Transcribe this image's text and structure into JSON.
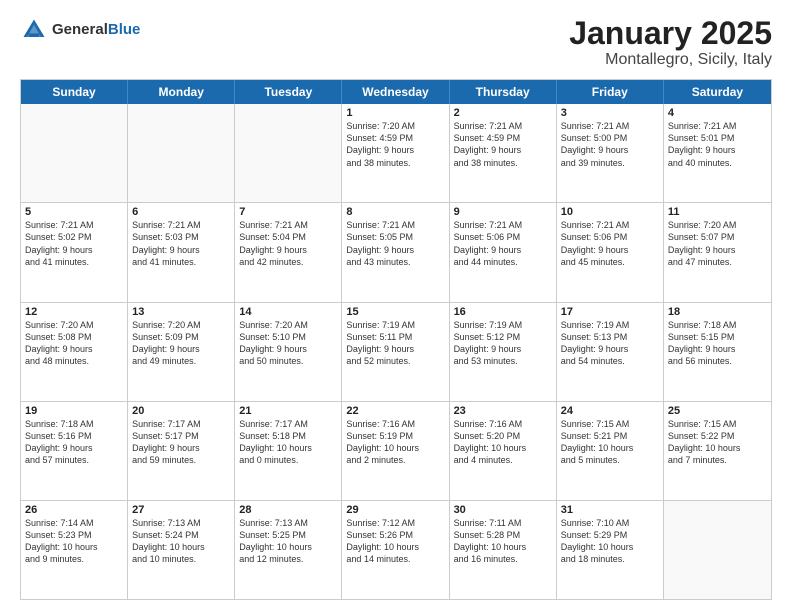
{
  "header": {
    "logo": {
      "general": "General",
      "blue": "Blue"
    },
    "title": "January 2025",
    "location": "Montallegro, Sicily, Italy"
  },
  "dayHeaders": [
    "Sunday",
    "Monday",
    "Tuesday",
    "Wednesday",
    "Thursday",
    "Friday",
    "Saturday"
  ],
  "weeks": [
    [
      {
        "day": "",
        "info": ""
      },
      {
        "day": "",
        "info": ""
      },
      {
        "day": "",
        "info": ""
      },
      {
        "day": "1",
        "info": "Sunrise: 7:20 AM\nSunset: 4:59 PM\nDaylight: 9 hours\nand 38 minutes."
      },
      {
        "day": "2",
        "info": "Sunrise: 7:21 AM\nSunset: 4:59 PM\nDaylight: 9 hours\nand 38 minutes."
      },
      {
        "day": "3",
        "info": "Sunrise: 7:21 AM\nSunset: 5:00 PM\nDaylight: 9 hours\nand 39 minutes."
      },
      {
        "day": "4",
        "info": "Sunrise: 7:21 AM\nSunset: 5:01 PM\nDaylight: 9 hours\nand 40 minutes."
      }
    ],
    [
      {
        "day": "5",
        "info": "Sunrise: 7:21 AM\nSunset: 5:02 PM\nDaylight: 9 hours\nand 41 minutes."
      },
      {
        "day": "6",
        "info": "Sunrise: 7:21 AM\nSunset: 5:03 PM\nDaylight: 9 hours\nand 41 minutes."
      },
      {
        "day": "7",
        "info": "Sunrise: 7:21 AM\nSunset: 5:04 PM\nDaylight: 9 hours\nand 42 minutes."
      },
      {
        "day": "8",
        "info": "Sunrise: 7:21 AM\nSunset: 5:05 PM\nDaylight: 9 hours\nand 43 minutes."
      },
      {
        "day": "9",
        "info": "Sunrise: 7:21 AM\nSunset: 5:06 PM\nDaylight: 9 hours\nand 44 minutes."
      },
      {
        "day": "10",
        "info": "Sunrise: 7:21 AM\nSunset: 5:06 PM\nDaylight: 9 hours\nand 45 minutes."
      },
      {
        "day": "11",
        "info": "Sunrise: 7:20 AM\nSunset: 5:07 PM\nDaylight: 9 hours\nand 47 minutes."
      }
    ],
    [
      {
        "day": "12",
        "info": "Sunrise: 7:20 AM\nSunset: 5:08 PM\nDaylight: 9 hours\nand 48 minutes."
      },
      {
        "day": "13",
        "info": "Sunrise: 7:20 AM\nSunset: 5:09 PM\nDaylight: 9 hours\nand 49 minutes."
      },
      {
        "day": "14",
        "info": "Sunrise: 7:20 AM\nSunset: 5:10 PM\nDaylight: 9 hours\nand 50 minutes."
      },
      {
        "day": "15",
        "info": "Sunrise: 7:19 AM\nSunset: 5:11 PM\nDaylight: 9 hours\nand 52 minutes."
      },
      {
        "day": "16",
        "info": "Sunrise: 7:19 AM\nSunset: 5:12 PM\nDaylight: 9 hours\nand 53 minutes."
      },
      {
        "day": "17",
        "info": "Sunrise: 7:19 AM\nSunset: 5:13 PM\nDaylight: 9 hours\nand 54 minutes."
      },
      {
        "day": "18",
        "info": "Sunrise: 7:18 AM\nSunset: 5:15 PM\nDaylight: 9 hours\nand 56 minutes."
      }
    ],
    [
      {
        "day": "19",
        "info": "Sunrise: 7:18 AM\nSunset: 5:16 PM\nDaylight: 9 hours\nand 57 minutes."
      },
      {
        "day": "20",
        "info": "Sunrise: 7:17 AM\nSunset: 5:17 PM\nDaylight: 9 hours\nand 59 minutes."
      },
      {
        "day": "21",
        "info": "Sunrise: 7:17 AM\nSunset: 5:18 PM\nDaylight: 10 hours\nand 0 minutes."
      },
      {
        "day": "22",
        "info": "Sunrise: 7:16 AM\nSunset: 5:19 PM\nDaylight: 10 hours\nand 2 minutes."
      },
      {
        "day": "23",
        "info": "Sunrise: 7:16 AM\nSunset: 5:20 PM\nDaylight: 10 hours\nand 4 minutes."
      },
      {
        "day": "24",
        "info": "Sunrise: 7:15 AM\nSunset: 5:21 PM\nDaylight: 10 hours\nand 5 minutes."
      },
      {
        "day": "25",
        "info": "Sunrise: 7:15 AM\nSunset: 5:22 PM\nDaylight: 10 hours\nand 7 minutes."
      }
    ],
    [
      {
        "day": "26",
        "info": "Sunrise: 7:14 AM\nSunset: 5:23 PM\nDaylight: 10 hours\nand 9 minutes."
      },
      {
        "day": "27",
        "info": "Sunrise: 7:13 AM\nSunset: 5:24 PM\nDaylight: 10 hours\nand 10 minutes."
      },
      {
        "day": "28",
        "info": "Sunrise: 7:13 AM\nSunset: 5:25 PM\nDaylight: 10 hours\nand 12 minutes."
      },
      {
        "day": "29",
        "info": "Sunrise: 7:12 AM\nSunset: 5:26 PM\nDaylight: 10 hours\nand 14 minutes."
      },
      {
        "day": "30",
        "info": "Sunrise: 7:11 AM\nSunset: 5:28 PM\nDaylight: 10 hours\nand 16 minutes."
      },
      {
        "day": "31",
        "info": "Sunrise: 7:10 AM\nSunset: 5:29 PM\nDaylight: 10 hours\nand 18 minutes."
      },
      {
        "day": "",
        "info": ""
      }
    ]
  ]
}
